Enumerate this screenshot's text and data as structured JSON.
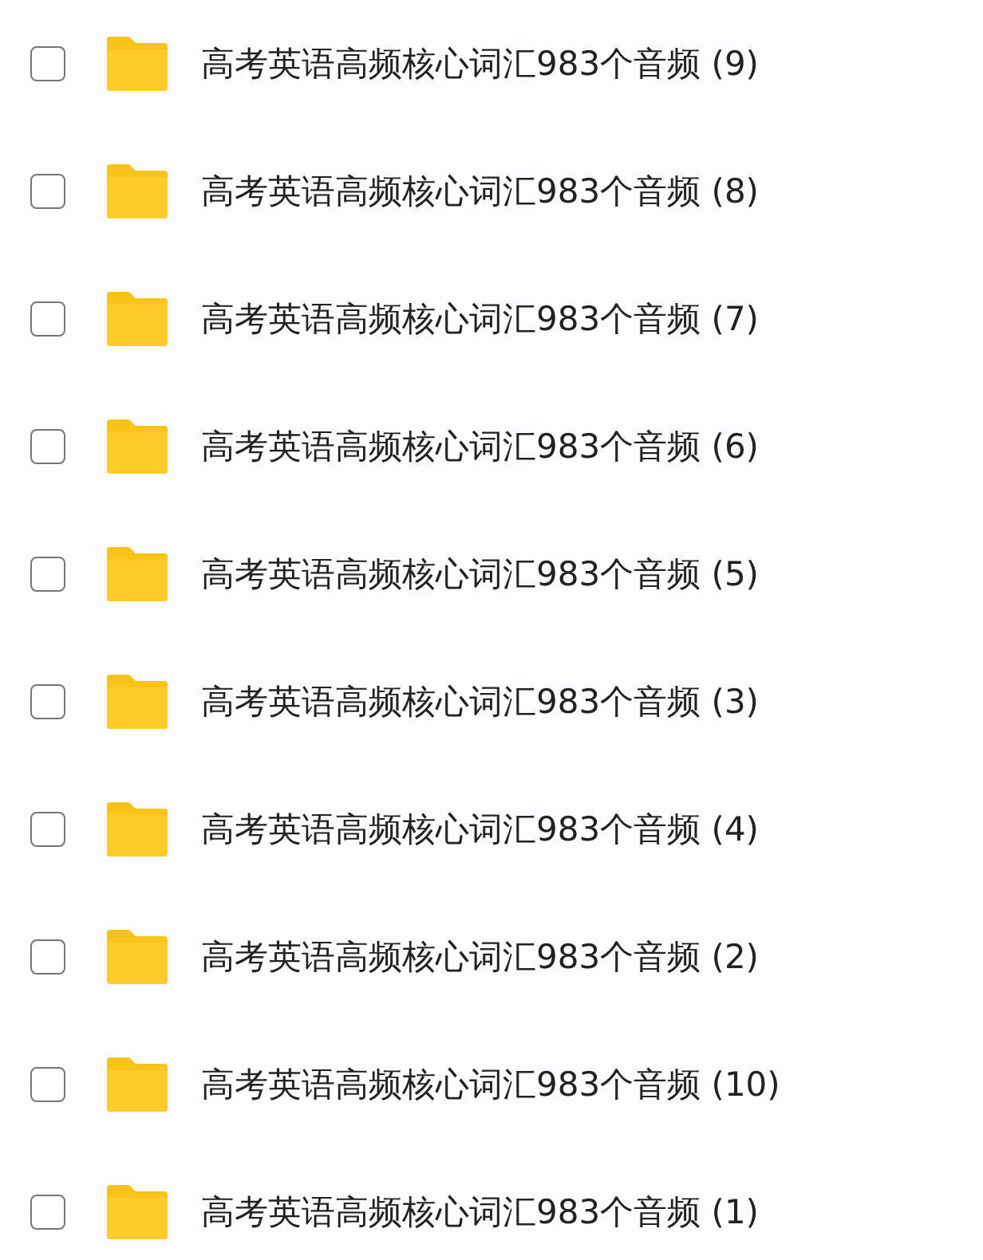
{
  "files": [
    {
      "name": "高考英语高频核心词汇983个音频 (9)",
      "checked": false
    },
    {
      "name": "高考英语高频核心词汇983个音频 (8)",
      "checked": false
    },
    {
      "name": "高考英语高频核心词汇983个音频 (7)",
      "checked": false
    },
    {
      "name": "高考英语高频核心词汇983个音频 (6)",
      "checked": false
    },
    {
      "name": "高考英语高频核心词汇983个音频 (5)",
      "checked": false
    },
    {
      "name": "高考英语高频核心词汇983个音频 (3)",
      "checked": false
    },
    {
      "name": "高考英语高频核心词汇983个音频 (4)",
      "checked": false
    },
    {
      "name": "高考英语高频核心词汇983个音频 (2)",
      "checked": false
    },
    {
      "name": "高考英语高频核心词汇983个音频 (10)",
      "checked": false
    },
    {
      "name": "高考英语高频核心词汇983个音频 (1)",
      "checked": false
    }
  ]
}
